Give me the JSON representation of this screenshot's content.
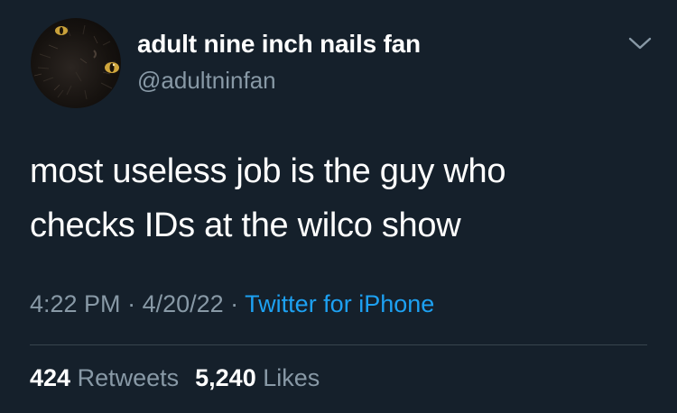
{
  "author": {
    "display_name": "adult nine inch nails fan",
    "handle": "@adultninfan",
    "avatar_icon": "cat-photo-avatar"
  },
  "menu_icon": "chevron-down-icon",
  "tweet": {
    "lines": [
      "most useless job is the guy who",
      "checks IDs at the wilco show"
    ]
  },
  "meta": {
    "time": "4:22 PM",
    "separator": " · ",
    "date": "4/20/22",
    "source": "Twitter for iPhone"
  },
  "stats": {
    "retweets_count": "424",
    "retweets_label": "Retweets",
    "likes_count": "5,240",
    "likes_label": "Likes"
  },
  "colors": {
    "background": "#15202b",
    "primary_text": "#ffffff",
    "secondary_text": "#8899a6",
    "link": "#1da1f2",
    "divider": "#38444d"
  }
}
